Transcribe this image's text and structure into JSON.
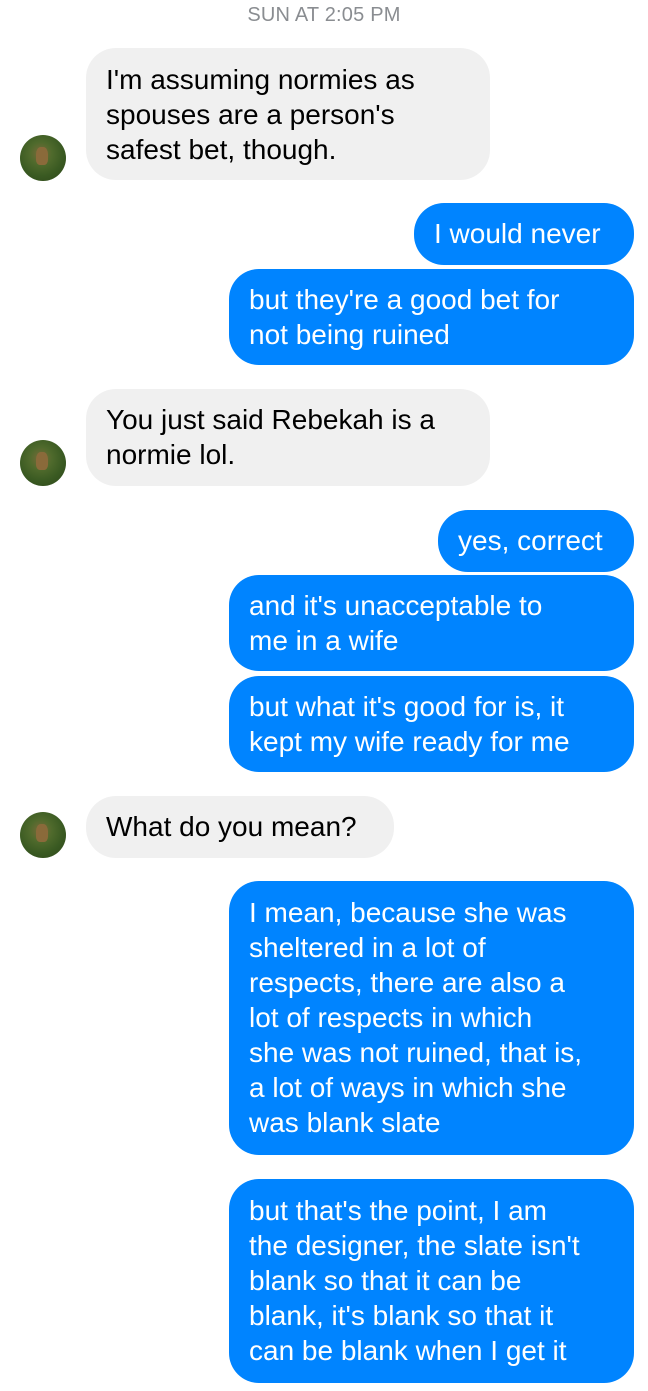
{
  "header": {
    "timestamp": "SUN AT 2:05 PM"
  },
  "messages": [
    {
      "text": "I'm assuming normies as\nspouses are a person's\nsafest bet, though."
    },
    {
      "text": "I would never"
    },
    {
      "text": "but they're a good bet for\nnot being ruined"
    },
    {
      "text": "You just said Rebekah is a\nnormie lol."
    },
    {
      "text": "yes, correct"
    },
    {
      "text": "and it's unacceptable to\nme in a wife"
    },
    {
      "text": "but what it's good for is, it\nkept my wife ready for me"
    },
    {
      "text": "What do you mean?"
    },
    {
      "text": "I mean, because she was\nsheltered in a lot of\nrespects, there are also a\nlot of respects in which\nshe was not ruined, that is,\na lot of ways in which she\nwas blank slate"
    },
    {
      "text": "but that's the point, I am\nthe designer, the slate isn't\nblank so that it can be\nblank, it's blank so that it\ncan be blank when I get it"
    }
  ],
  "colors": {
    "outgoing": "#0084ff",
    "incoming": "#f0f0f0",
    "timestamp": "#8a8d91"
  },
  "icons": {
    "avatar": "contact-avatar-icon"
  }
}
